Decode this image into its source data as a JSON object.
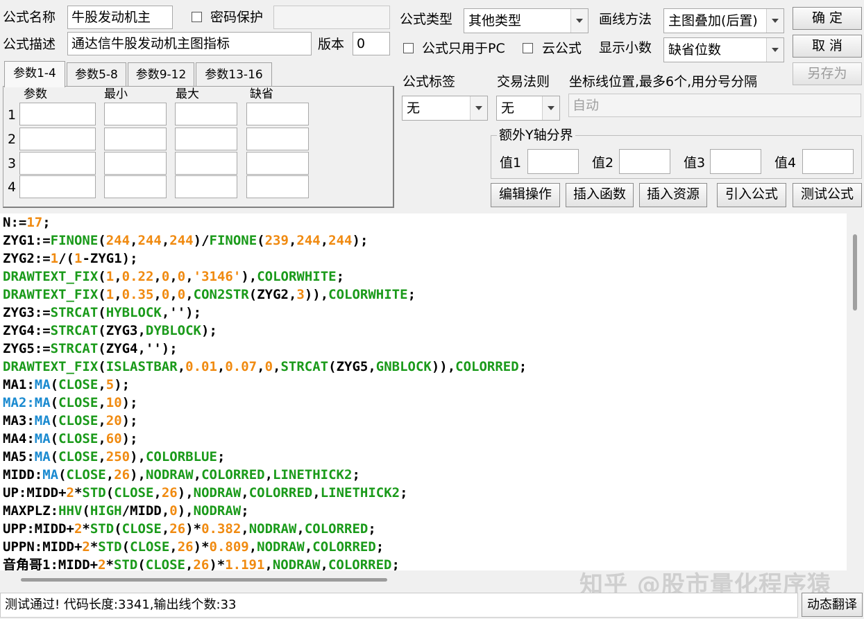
{
  "header": {
    "formula_name_label": "公式名称",
    "formula_name_value": "牛股发动机主",
    "password_protect_label": "密码保护",
    "password_value": "",
    "formula_desc_label": "公式描述",
    "formula_desc_value": "通达信牛股发动机主图指标",
    "version_label": "版本",
    "version_value": "0",
    "formula_type_label": "公式类型",
    "formula_type_value": "其他类型",
    "draw_method_label": "画线方法",
    "draw_method_value": "主图叠加(后置)",
    "pc_only_label": "公式只用于PC",
    "cloud_label": "云公式",
    "decimal_label": "显示小数",
    "decimal_value": "缺省位数"
  },
  "buttons": {
    "ok": "确 定",
    "cancel": "取 消",
    "save_as": "另存为",
    "edit_ops": "编辑操作",
    "insert_func": "插入函数",
    "insert_resource": "插入资源",
    "import_formula": "引入公式",
    "test_formula": "测试公式",
    "dynamic_translate": "动态翻译"
  },
  "params": {
    "tabs": [
      "参数1-4",
      "参数5-8",
      "参数9-12",
      "参数13-16"
    ],
    "columns": [
      "参数",
      "最小",
      "最大",
      "缺省"
    ],
    "rows": [
      "1",
      "2",
      "3",
      "4"
    ]
  },
  "tags": {
    "formula_tag_label": "公式标签",
    "formula_tag_value": "无",
    "trade_rule_label": "交易法则",
    "trade_rule_value": "无",
    "axis_label": "坐标线位置,最多6个,用分号分隔",
    "axis_value": "自动"
  },
  "extra_y": {
    "title": "额外Y轴分界",
    "v1": "值1",
    "v2": "值2",
    "v3": "值3",
    "v4": "值4"
  },
  "code_lines": [
    [
      [
        "N:=",
        "def"
      ],
      [
        "17",
        "num"
      ],
      [
        ";",
        "def"
      ]
    ],
    [
      [
        "ZYG1:=",
        "def"
      ],
      [
        "FINONE",
        "kw"
      ],
      [
        "(",
        "def"
      ],
      [
        "244",
        "num"
      ],
      [
        ",",
        "def"
      ],
      [
        "244",
        "num"
      ],
      [
        ",",
        "def"
      ],
      [
        "244",
        "num"
      ],
      [
        ")/",
        "def"
      ],
      [
        "FINONE",
        "kw"
      ],
      [
        "(",
        "def"
      ],
      [
        "239",
        "num"
      ],
      [
        ",",
        "def"
      ],
      [
        "244",
        "num"
      ],
      [
        ",",
        "def"
      ],
      [
        "244",
        "num"
      ],
      [
        ");",
        "def"
      ]
    ],
    [
      [
        "ZYG2:=",
        "def"
      ],
      [
        "1",
        "num"
      ],
      [
        "/(",
        "def"
      ],
      [
        "1",
        "num"
      ],
      [
        "-ZYG1);",
        "def"
      ]
    ],
    [
      [
        "DRAWTEXT_FIX",
        "kw"
      ],
      [
        "(",
        "def"
      ],
      [
        "1",
        "num"
      ],
      [
        ",",
        "def"
      ],
      [
        "0.22",
        "num"
      ],
      [
        ",",
        "def"
      ],
      [
        "0",
        "num"
      ],
      [
        ",",
        "def"
      ],
      [
        "0",
        "num"
      ],
      [
        ",",
        "def"
      ],
      [
        "'3146'",
        "str"
      ],
      [
        "),",
        "def"
      ],
      [
        "COLORWHITE",
        "kw"
      ],
      [
        ";",
        "def"
      ]
    ],
    [
      [
        "DRAWTEXT_FIX",
        "kw"
      ],
      [
        "(",
        "def"
      ],
      [
        "1",
        "num"
      ],
      [
        ",",
        "def"
      ],
      [
        "0.35",
        "num"
      ],
      [
        ",",
        "def"
      ],
      [
        "0",
        "num"
      ],
      [
        ",",
        "def"
      ],
      [
        "0",
        "num"
      ],
      [
        ",",
        "def"
      ],
      [
        "CON2STR",
        "kw"
      ],
      [
        "(ZYG2,",
        "def"
      ],
      [
        "3",
        "num"
      ],
      [
        ")),",
        "def"
      ],
      [
        "COLORWHITE",
        "kw"
      ],
      [
        ";",
        "def"
      ]
    ],
    [
      [
        "ZYG3:=",
        "def"
      ],
      [
        "STRCAT",
        "kw"
      ],
      [
        "(",
        "def"
      ],
      [
        "HYBLOCK",
        "kw"
      ],
      [
        ",'');",
        "def"
      ]
    ],
    [
      [
        "ZYG4:=",
        "def"
      ],
      [
        "STRCAT",
        "kw"
      ],
      [
        "(ZYG3,",
        "def"
      ],
      [
        "DYBLOCK",
        "kw"
      ],
      [
        ");",
        "def"
      ]
    ],
    [
      [
        "ZYG5:=",
        "def"
      ],
      [
        "STRCAT",
        "kw"
      ],
      [
        "(ZYG4,'');",
        "def"
      ]
    ],
    [
      [
        "DRAWTEXT_FIX",
        "kw"
      ],
      [
        "(",
        "def"
      ],
      [
        "ISLASTBAR",
        "kw"
      ],
      [
        ",",
        "def"
      ],
      [
        "0.01",
        "num"
      ],
      [
        ",",
        "def"
      ],
      [
        "0.07",
        "num"
      ],
      [
        ",",
        "def"
      ],
      [
        "0",
        "num"
      ],
      [
        ",",
        "def"
      ],
      [
        "STRCAT",
        "kw"
      ],
      [
        "(ZYG5,",
        "def"
      ],
      [
        "GNBLOCK",
        "kw"
      ],
      [
        ")),",
        "def"
      ],
      [
        "COLORRED",
        "kw"
      ],
      [
        ";",
        "def"
      ]
    ],
    [
      [
        "MA1:",
        "def"
      ],
      [
        "MA",
        "fn"
      ],
      [
        "(",
        "def"
      ],
      [
        "CLOSE",
        "kw"
      ],
      [
        ",",
        "def"
      ],
      [
        "5",
        "num"
      ],
      [
        ");",
        "def"
      ]
    ],
    [
      [
        "MA2:",
        "fn"
      ],
      [
        "MA",
        "fn"
      ],
      [
        "(",
        "def"
      ],
      [
        "CLOSE",
        "kw"
      ],
      [
        ",",
        "def"
      ],
      [
        "10",
        "num"
      ],
      [
        ");",
        "def"
      ]
    ],
    [
      [
        "MA3:",
        "def"
      ],
      [
        "MA",
        "fn"
      ],
      [
        "(",
        "def"
      ],
      [
        "CLOSE",
        "kw"
      ],
      [
        ",",
        "def"
      ],
      [
        "20",
        "num"
      ],
      [
        ");",
        "def"
      ]
    ],
    [
      [
        "MA4:",
        "def"
      ],
      [
        "MA",
        "fn"
      ],
      [
        "(",
        "def"
      ],
      [
        "CLOSE",
        "kw"
      ],
      [
        ",",
        "def"
      ],
      [
        "60",
        "num"
      ],
      [
        ");",
        "def"
      ]
    ],
    [
      [
        "MA5:",
        "def"
      ],
      [
        "MA",
        "fn"
      ],
      [
        "(",
        "def"
      ],
      [
        "CLOSE",
        "kw"
      ],
      [
        ",",
        "def"
      ],
      [
        "250",
        "num"
      ],
      [
        "),",
        "def"
      ],
      [
        "COLORBLUE",
        "kw"
      ],
      [
        ";",
        "def"
      ]
    ],
    [
      [
        "MIDD:",
        "def"
      ],
      [
        "MA",
        "fn"
      ],
      [
        "(",
        "def"
      ],
      [
        "CLOSE",
        "kw"
      ],
      [
        ",",
        "def"
      ],
      [
        "26",
        "num"
      ],
      [
        "),",
        "def"
      ],
      [
        "NODRAW",
        "kw"
      ],
      [
        ",",
        "def"
      ],
      [
        "COLORRED",
        "kw"
      ],
      [
        ",",
        "def"
      ],
      [
        "LINETHICK2",
        "kw"
      ],
      [
        ";",
        "def"
      ]
    ],
    [
      [
        "UP:MIDD+",
        "def"
      ],
      [
        "2",
        "num"
      ],
      [
        "*",
        "def"
      ],
      [
        "STD",
        "kw"
      ],
      [
        "(",
        "def"
      ],
      [
        "CLOSE",
        "kw"
      ],
      [
        ",",
        "def"
      ],
      [
        "26",
        "num"
      ],
      [
        "),",
        "def"
      ],
      [
        "NODRAW",
        "kw"
      ],
      [
        ",",
        "def"
      ],
      [
        "COLORRED",
        "kw"
      ],
      [
        ",",
        "def"
      ],
      [
        "LINETHICK2",
        "kw"
      ],
      [
        ";",
        "def"
      ]
    ],
    [
      [
        "MAXPLZ:",
        "def"
      ],
      [
        "HHV",
        "kw"
      ],
      [
        "(",
        "def"
      ],
      [
        "HIGH",
        "kw"
      ],
      [
        "/MIDD,",
        "def"
      ],
      [
        "0",
        "num"
      ],
      [
        "),",
        "def"
      ],
      [
        "NODRAW",
        "kw"
      ],
      [
        ";",
        "def"
      ]
    ],
    [
      [
        "UPP:MIDD+",
        "def"
      ],
      [
        "2",
        "num"
      ],
      [
        "*",
        "def"
      ],
      [
        "STD",
        "kw"
      ],
      [
        "(",
        "def"
      ],
      [
        "CLOSE",
        "kw"
      ],
      [
        ",",
        "def"
      ],
      [
        "26",
        "num"
      ],
      [
        ")*",
        "def"
      ],
      [
        "0.382",
        "num"
      ],
      [
        ",",
        "def"
      ],
      [
        "NODRAW",
        "kw"
      ],
      [
        ",",
        "def"
      ],
      [
        "COLORRED",
        "kw"
      ],
      [
        ";",
        "def"
      ]
    ],
    [
      [
        "UPPN:MIDD+",
        "def"
      ],
      [
        "2",
        "num"
      ],
      [
        "*",
        "def"
      ],
      [
        "STD",
        "kw"
      ],
      [
        "(",
        "def"
      ],
      [
        "CLOSE",
        "kw"
      ],
      [
        ",",
        "def"
      ],
      [
        "26",
        "num"
      ],
      [
        ")*",
        "def"
      ],
      [
        "0.809",
        "num"
      ],
      [
        ",",
        "def"
      ],
      [
        "NODRAW",
        "kw"
      ],
      [
        ",",
        "def"
      ],
      [
        "COLORRED",
        "kw"
      ],
      [
        ";",
        "def"
      ]
    ],
    [
      [
        "音角哥1:MIDD+",
        "def"
      ],
      [
        "2",
        "num"
      ],
      [
        "*",
        "def"
      ],
      [
        "STD",
        "kw"
      ],
      [
        "(",
        "def"
      ],
      [
        "CLOSE",
        "kw"
      ],
      [
        ",",
        "def"
      ],
      [
        "26",
        "num"
      ],
      [
        ")*",
        "def"
      ],
      [
        "1.191",
        "num"
      ],
      [
        ",",
        "def"
      ],
      [
        "NODRAW",
        "kw"
      ],
      [
        ",",
        "def"
      ],
      [
        "COLORRED",
        "kw"
      ],
      [
        ";",
        "def"
      ]
    ]
  ],
  "status_text": "测试通过! 代码长度:3341,输出线个数:33",
  "watermark": "知乎 @股市量化程序猿"
}
